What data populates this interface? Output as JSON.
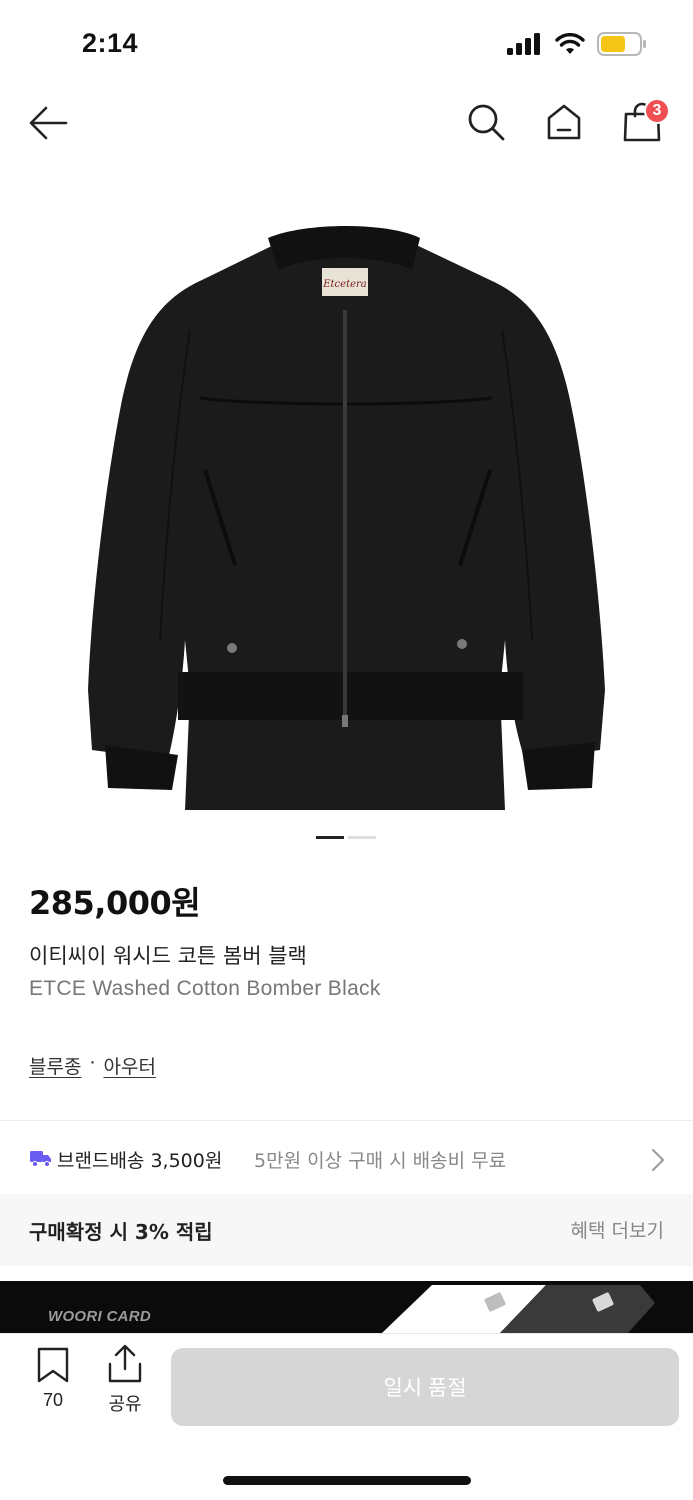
{
  "status_bar": {
    "time": "2:14",
    "icons": [
      "signal-icon",
      "wifi-icon",
      "battery-icon"
    ],
    "battery_color": "#f5c518"
  },
  "nav": {
    "icons": [
      "back-arrow-icon",
      "search-icon",
      "home-icon",
      "shopping-bag-icon"
    ],
    "cart_count": "3",
    "badge_color": "#ef4e52"
  },
  "gallery": {
    "image": "black-bomber-jacket",
    "label_text": "Etcetera",
    "page_count": 2,
    "active_page": 1
  },
  "product": {
    "price": "285,000원",
    "name_ko": "이티씨이 워시드 코튼 봄버 블랙",
    "name_en": "ETCE Washed Cotton Bomber Black",
    "category": [
      "블루종",
      "아우터"
    ],
    "category_separator": "·"
  },
  "shipping": {
    "label": "브랜드배송 3,500원",
    "note": "5만원 이상 구매 시 배송비 무료",
    "icon": "truck-icon",
    "icon_color": "#6a5cf0"
  },
  "benefit": {
    "text": "구매확정 시 3% 적립",
    "more_label": "혜택 더보기"
  },
  "card_banner": {
    "label": "WOORI CARD"
  },
  "bottom_bar": {
    "bookmark_count": "70",
    "share_label": "공유",
    "soldout_label": "일시 품절"
  }
}
